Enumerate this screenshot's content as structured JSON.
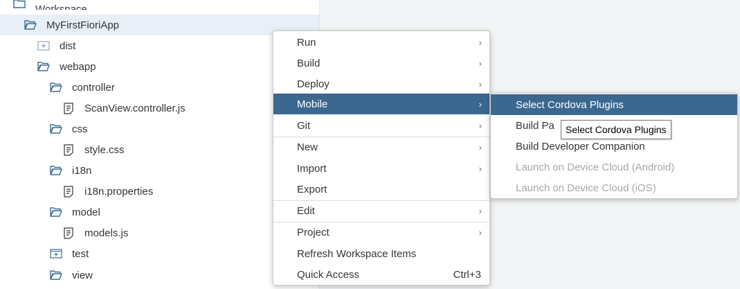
{
  "tree": {
    "items": [
      {
        "label": "Workspace",
        "icon": "folder-open-icon"
      },
      {
        "label": "MyFirstFioriApp",
        "icon": "folder-open-icon"
      },
      {
        "label": "dist",
        "icon": "folder-closed-icon"
      },
      {
        "label": "webapp",
        "icon": "folder-open-icon"
      },
      {
        "label": "controller",
        "icon": "folder-open-icon"
      },
      {
        "label": "ScanView.controller.js",
        "icon": "file-icon"
      },
      {
        "label": "css",
        "icon": "folder-open-icon"
      },
      {
        "label": "style.css",
        "icon": "file-icon"
      },
      {
        "label": "i18n",
        "icon": "folder-open-icon"
      },
      {
        "label": "i18n.properties",
        "icon": "file-icon"
      },
      {
        "label": "model",
        "icon": "folder-open-icon"
      },
      {
        "label": "models.js",
        "icon": "file-icon"
      },
      {
        "label": "test",
        "icon": "folder-closed-icon"
      },
      {
        "label": "view",
        "icon": "folder-open-icon"
      }
    ]
  },
  "context_menu": {
    "items": [
      {
        "label": "Run"
      },
      {
        "label": "Build"
      },
      {
        "label": "Deploy"
      },
      {
        "label": "Mobile"
      },
      {
        "label": "Git"
      },
      {
        "label": "New"
      },
      {
        "label": "Import"
      },
      {
        "label": "Export"
      },
      {
        "label": "Edit"
      },
      {
        "label": "Project"
      },
      {
        "label": "Refresh Workspace Items"
      },
      {
        "label": "Quick Access",
        "shortcut": "Ctrl+3"
      }
    ],
    "arrow": "›"
  },
  "mobile_submenu": {
    "items": [
      {
        "label": "Select Cordova Plugins"
      },
      {
        "label": "Build Pa"
      },
      {
        "label": "Build Developer Companion"
      },
      {
        "label": "Launch on Device Cloud (Android)"
      },
      {
        "label": "Launch on Device Cloud (iOS)"
      }
    ]
  },
  "tooltip": {
    "text": "Select Cordova Plugins"
  },
  "colors": {
    "accent": "#3c6890",
    "selection": "#e8eff6",
    "disabled": "#a6a8ab"
  }
}
